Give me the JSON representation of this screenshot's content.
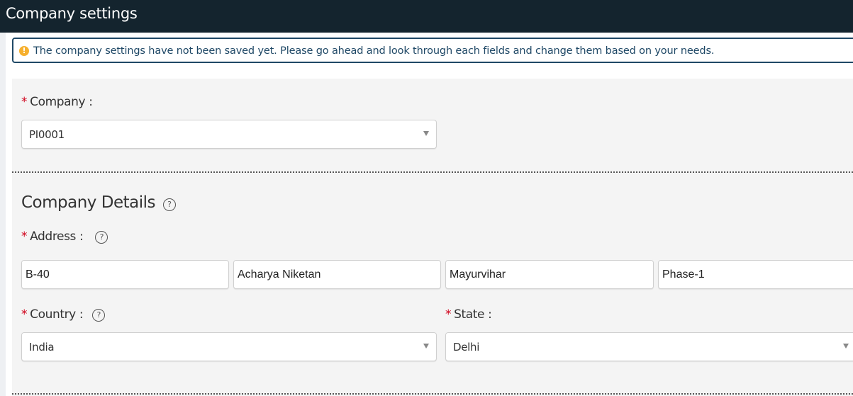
{
  "header": {
    "title": "Company settings"
  },
  "notice": {
    "icon": "warning-icon",
    "icon_glyph": "!",
    "text": "The company settings have not been saved yet. Please go ahead and look through each fields and change them based on your needs."
  },
  "company": {
    "required_mark": "*",
    "label": "Company :",
    "value": "PI0001"
  },
  "details": {
    "title": "Company Details",
    "help_glyph": "?",
    "address": {
      "required_mark": "*",
      "label": "Address :",
      "lines": [
        "B-40",
        "Acharya Niketan",
        "Mayurvihar",
        "Phase-1"
      ]
    },
    "country": {
      "required_mark": "*",
      "label": "Country :",
      "value": "India"
    },
    "state": {
      "required_mark": "*",
      "label": "State :",
      "value": "Delhi"
    }
  },
  "colors": {
    "header_bg": "#14242e",
    "notice_border": "#1f4866",
    "warning": "#f6b02e",
    "required": "#d0021b",
    "panel_bg": "#f4f4f4"
  }
}
